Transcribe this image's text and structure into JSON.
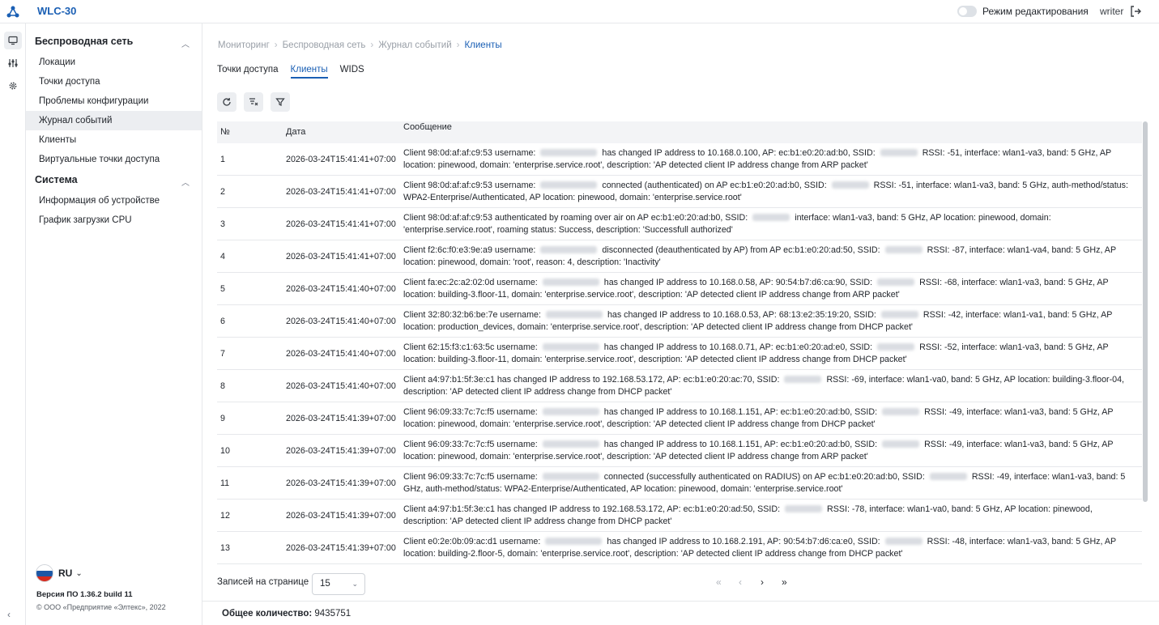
{
  "app": {
    "title": "WLC-30"
  },
  "header": {
    "edit_mode_label": "Режим редактирования",
    "edit_mode_on": false,
    "user": "writer"
  },
  "sidebar": {
    "sections": [
      {
        "title": "Беспроводная сеть",
        "expanded": true,
        "items": [
          "Локации",
          "Точки доступа",
          "Проблемы конфигурации",
          "Журнал событий",
          "Клиенты",
          "Виртуальные точки доступа"
        ]
      },
      {
        "title": "Система",
        "expanded": true,
        "items": [
          "Информация об устройстве",
          "График загрузки CPU"
        ]
      }
    ],
    "active_item": "Журнал событий",
    "language": "RU",
    "version": "Версия ПО 1.36.2 build 11",
    "copyright": "© ООО «Предприятие «Элтекс», 2022"
  },
  "breadcrumb": [
    "Мониторинг",
    "Беспроводная сеть",
    "Журнал событий",
    "Клиенты"
  ],
  "tabs": [
    {
      "label": "Точки доступа",
      "active": false
    },
    {
      "label": "Клиенты",
      "active": true
    },
    {
      "label": "WIDS",
      "active": false
    }
  ],
  "table": {
    "headers": [
      "№",
      "Дата",
      "Сообщение"
    ],
    "rows": [
      {
        "num": "1",
        "date": "2026-03-24T15:41:41+07:00",
        "parts": [
          "Client 98:0d:af:af:c9:53 username:",
          "has changed IP address to 10.168.0.100, AP: ec:b1:e0:20:ad:b0, SSID:",
          "RSSI: -51, interface: wlan1-va3, band: 5 GHz, AP location: pinewood, domain: 'enterprise.service.root', description: 'AP detected client IP address change from ARP packet'"
        ]
      },
      {
        "num": "2",
        "date": "2026-03-24T15:41:41+07:00",
        "parts": [
          "Client 98:0d:af:af:c9:53 username:",
          "connected (authenticated) on AP ec:b1:e0:20:ad:b0, SSID:",
          "RSSI: -51, interface: wlan1-va3, band: 5 GHz, auth-method/status: WPA2-Enterprise/Authenticated, AP location: pinewood, domain: 'enterprise.service.root'"
        ]
      },
      {
        "num": "3",
        "date": "2026-03-24T15:41:41+07:00",
        "parts": [
          "Client 98:0d:af:af:c9:53 authenticated by roaming over air on AP ec:b1:e0:20:ad:b0, SSID:",
          "interface: wlan1-va3, band: 5 GHz, AP location: pinewood, domain: 'enterprise.service.root', roaming status: Success, description: 'Successfull authorized'"
        ]
      },
      {
        "num": "4",
        "date": "2026-03-24T15:41:41+07:00",
        "parts": [
          "Client f2:6c:f0:e3:9e:a9 username:",
          "disconnected (deauthenticated by AP) from AP ec:b1:e0:20:ad:50, SSID:",
          "RSSI: -87, interface: wlan1-va4, band: 5 GHz, AP location: pinewood, domain: 'root', reason: 4, description: 'Inactivity'"
        ]
      },
      {
        "num": "5",
        "date": "2026-03-24T15:41:40+07:00",
        "parts": [
          "Client fa:ec:2c:a2:02:0d username:",
          "has changed IP address to 10.168.0.58, AP: 90:54:b7:d6:ca:90, SSID:",
          "RSSI: -68, interface: wlan1-va3, band: 5 GHz, AP location: building-3.floor-11, domain: 'enterprise.service.root', description: 'AP detected client IP address change from ARP packet'"
        ]
      },
      {
        "num": "6",
        "date": "2026-03-24T15:41:40+07:00",
        "parts": [
          "Client 32:80:32:b6:be:7e username:",
          "has changed IP address to 10.168.0.53, AP: 68:13:e2:35:19:20, SSID:",
          "RSSI: -42, interface: wlan1-va1, band: 5 GHz, AP location: production_devices, domain: 'enterprise.service.root', description: 'AP detected client IP address change from DHCP packet'"
        ]
      },
      {
        "num": "7",
        "date": "2026-03-24T15:41:40+07:00",
        "parts": [
          "Client 62:15:f3:c1:63:5c username:",
          "has changed IP address to 10.168.0.71, AP: ec:b1:e0:20:ad:e0, SSID:",
          "RSSI: -52, interface: wlan1-va3, band: 5 GHz, AP location: building-3.floor-11, domain: 'enterprise.service.root', description: 'AP detected client IP address change from DHCP packet'"
        ]
      },
      {
        "num": "8",
        "date": "2026-03-24T15:41:40+07:00",
        "parts": [
          "Client a4:97:b1:5f:3e:c1 has changed IP address to 192.168.53.172, AP: ec:b1:e0:20:ac:70, SSID:",
          "RSSI: -69, interface: wlan1-va0, band: 5 GHz, AP location: building-3.floor-04, description: 'AP detected client IP address change from DHCP packet'"
        ]
      },
      {
        "num": "9",
        "date": "2026-03-24T15:41:39+07:00",
        "parts": [
          "Client 96:09:33:7c:7c:f5 username:",
          "has changed IP address to 10.168.1.151, AP: ec:b1:e0:20:ad:b0, SSID:",
          "RSSI: -49, interface: wlan1-va3, band: 5 GHz, AP location: pinewood, domain: 'enterprise.service.root', description: 'AP detected client IP address change from DHCP packet'"
        ]
      },
      {
        "num": "10",
        "date": "2026-03-24T15:41:39+07:00",
        "parts": [
          "Client 96:09:33:7c:7c:f5 username:",
          "has changed IP address to 10.168.1.151, AP: ec:b1:e0:20:ad:b0, SSID:",
          "RSSI: -49, interface: wlan1-va3, band: 5 GHz, AP location: pinewood, domain: 'enterprise.service.root', description: 'AP detected client IP address change from ARP packet'"
        ]
      },
      {
        "num": "11",
        "date": "2026-03-24T15:41:39+07:00",
        "parts": [
          "Client 96:09:33:7c:7c:f5 username:",
          "connected (successfully authenticated on RADIUS) on AP ec:b1:e0:20:ad:b0, SSID:",
          "RSSI: -49, interface: wlan1-va3, band: 5 GHz, auth-method/status: WPA2-Enterprise/Authenticated, AP location: pinewood, domain: 'enterprise.service.root'"
        ]
      },
      {
        "num": "12",
        "date": "2026-03-24T15:41:39+07:00",
        "parts": [
          "Client a4:97:b1:5f:3e:c1 has changed IP address to 192.168.53.172, AP: ec:b1:e0:20:ad:50, SSID:",
          "RSSI: -78, interface: wlan1-va0, band: 5 GHz, AP location: pinewood, description: 'AP detected client IP address change from DHCP packet'"
        ]
      },
      {
        "num": "13",
        "date": "2026-03-24T15:41:39+07:00",
        "parts": [
          "Client e0:2e:0b:09:ac:d1 username:",
          "has changed IP address to 10.168.2.191, AP: 90:54:b7:d6:ca:e0, SSID:",
          "RSSI: -48, interface: wlan1-va3, band: 5 GHz, AP location: building-2.floor-5, domain: 'enterprise.service.root', description: 'AP detected client IP address change from DHCP packet'"
        ]
      }
    ]
  },
  "pagination": {
    "page_size_label": "Записей на странице",
    "page_size": "15",
    "first": "«",
    "prev": "‹",
    "next": "›",
    "last": "»"
  },
  "footer": {
    "total_label": "Общее количество:",
    "total_value": "9435751"
  },
  "colors": {
    "accent": "#1a5fb4",
    "active_bg": "#eceef1",
    "header_bg": "#f3f4f6"
  }
}
